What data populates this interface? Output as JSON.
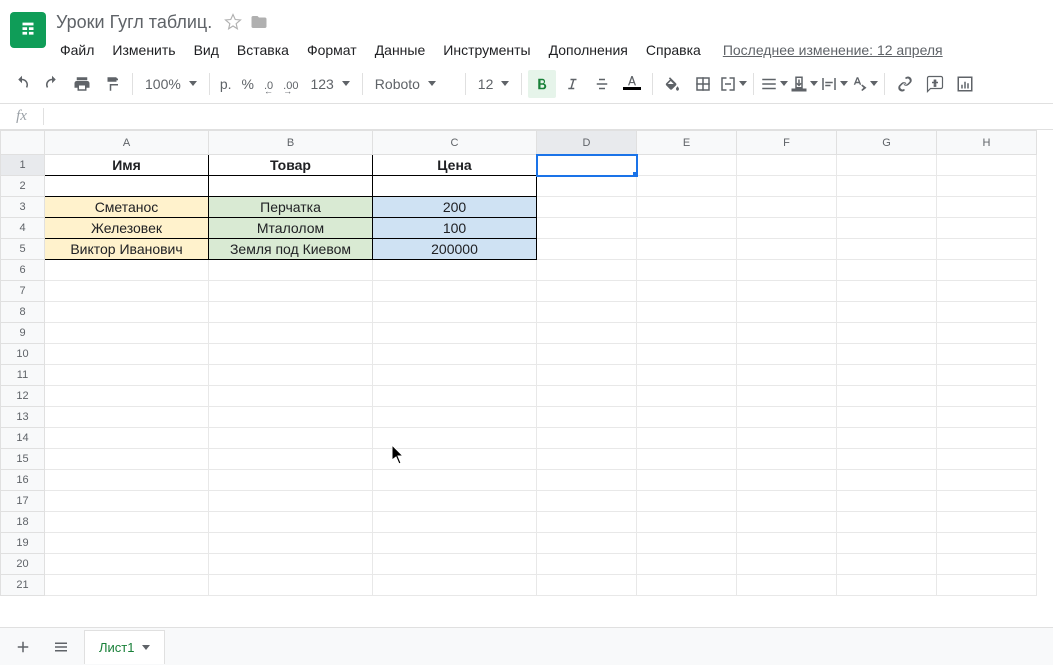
{
  "doc": {
    "title": "Уроки Гугл таблиц."
  },
  "last_change": "Последнее изменение: 12 апреля",
  "menu": {
    "file": "Файл",
    "edit": "Изменить",
    "view": "Вид",
    "insert": "Вставка",
    "format": "Формат",
    "data": "Данные",
    "tools": "Инструменты",
    "addons": "Дополнения",
    "help": "Справка"
  },
  "toolbar": {
    "zoom": "100%",
    "currency": "р.",
    "percent": "%",
    "dec_dec": ".0",
    "dec_inc": ".00",
    "numfmt": "123",
    "font": "Roboto",
    "font_size": "12"
  },
  "grid": {
    "columns": [
      "A",
      "B",
      "C",
      "D",
      "E",
      "F",
      "G",
      "H"
    ],
    "row_count": 21,
    "selected": {
      "col": "D",
      "row": 1
    },
    "rows": [
      {
        "A": "Имя",
        "B": "Товар",
        "C": "Цена"
      },
      {},
      {
        "A": "Сметанос",
        "B": "Перчатка",
        "C": "200"
      },
      {
        "A": "Железовек",
        "B": "Мталолом",
        "C": "100"
      },
      {
        "A": "Виктор Иванович",
        "B": "Земля под Киевом",
        "C": "200000"
      }
    ]
  },
  "sheet_tab": {
    "name": "Лист1"
  }
}
